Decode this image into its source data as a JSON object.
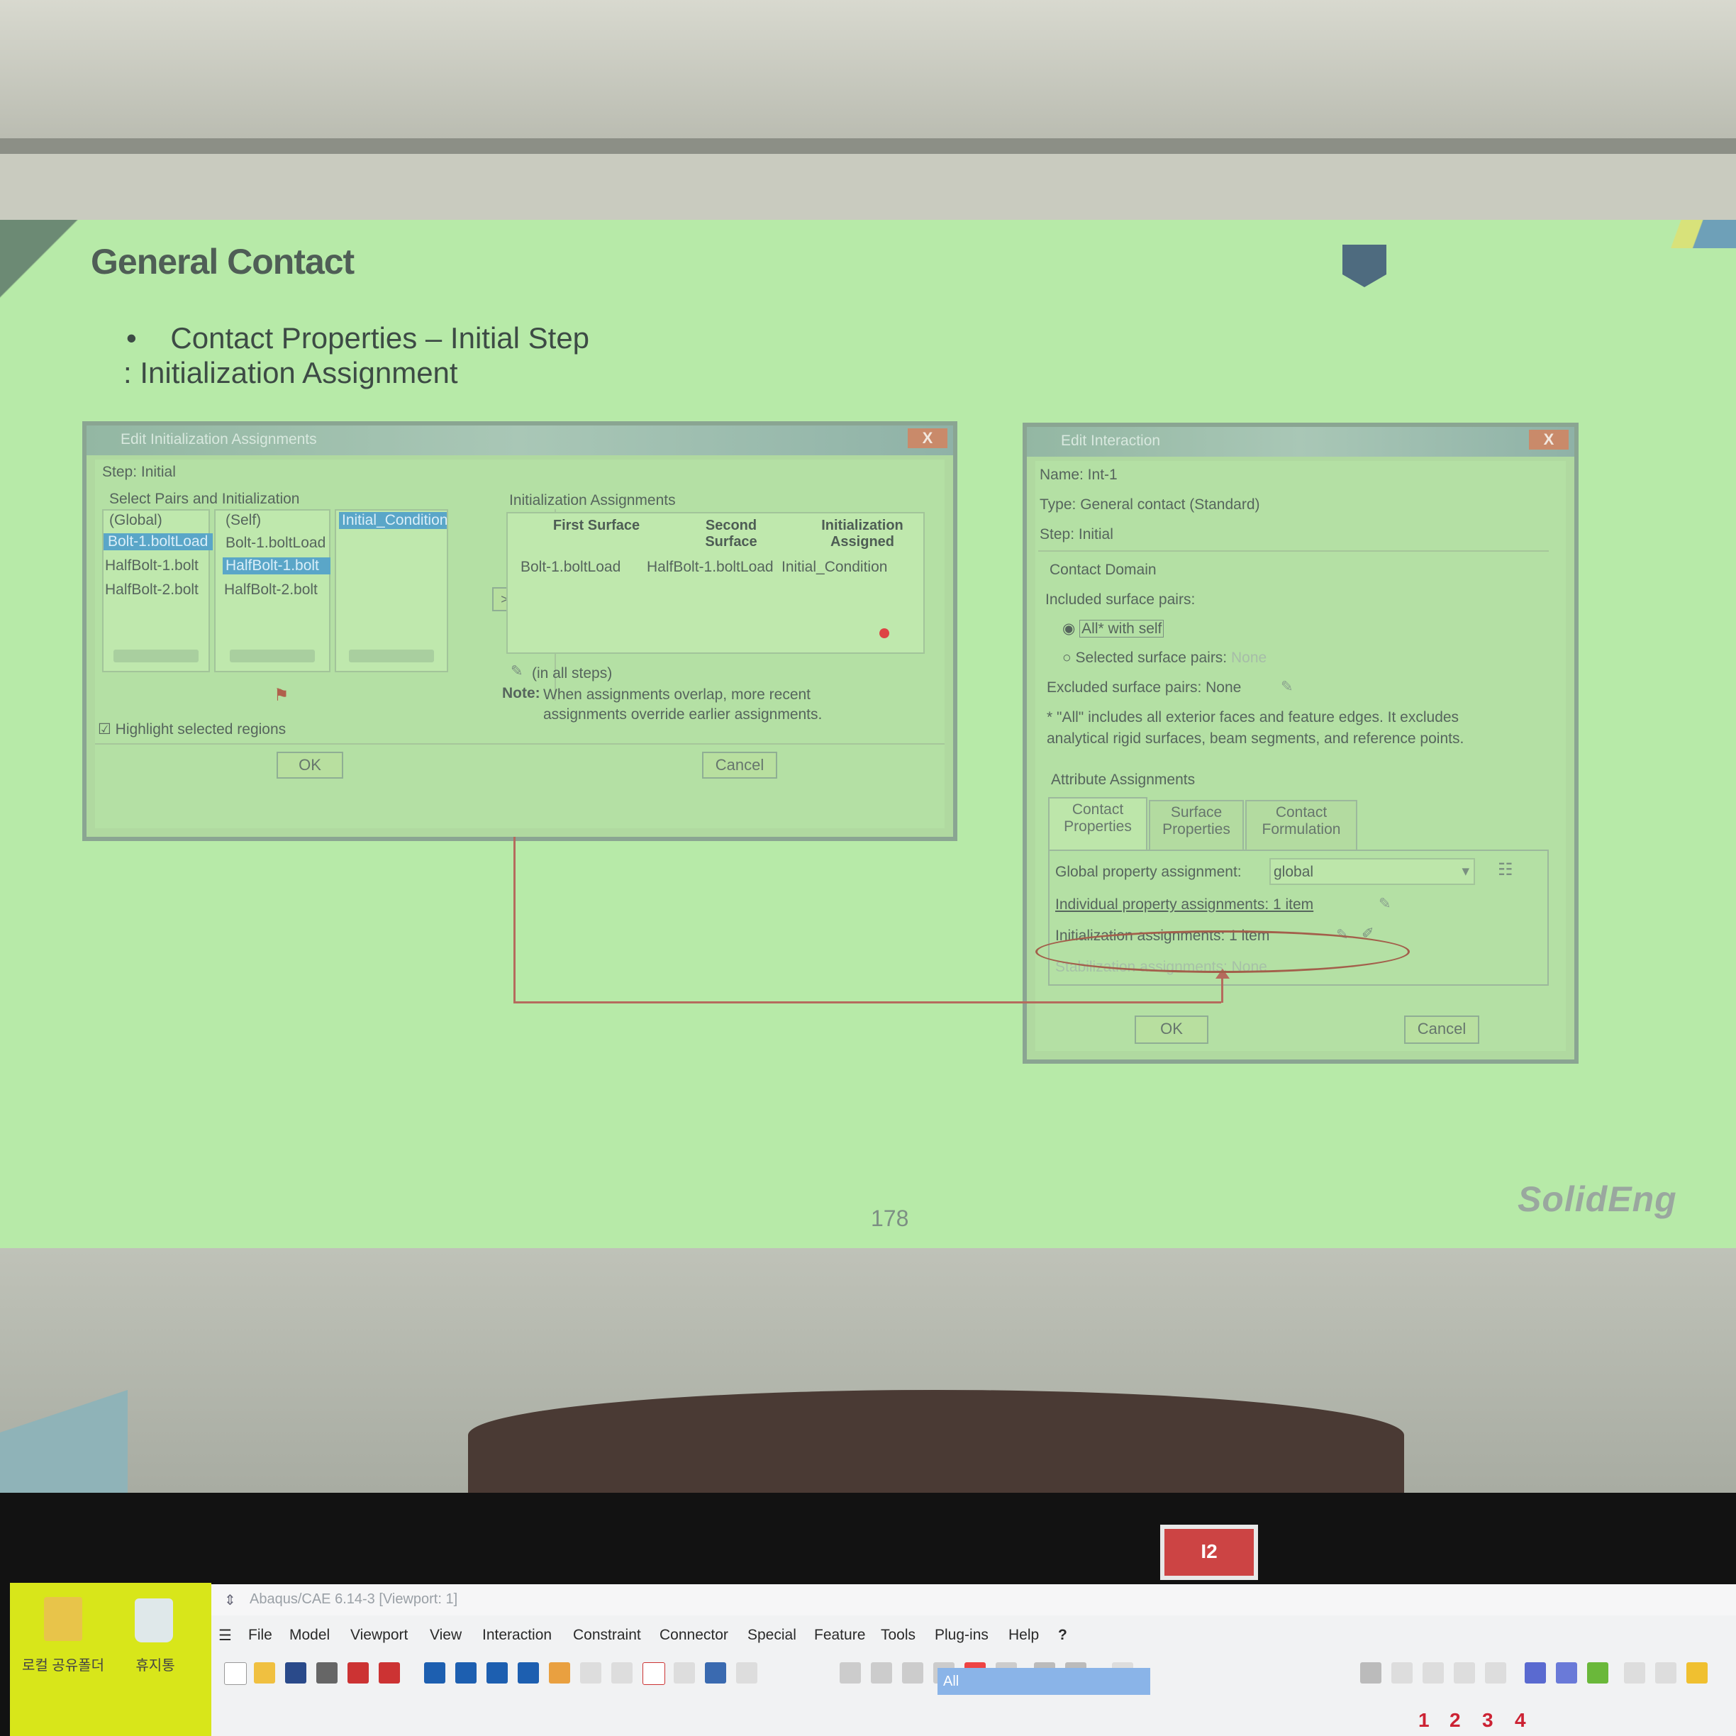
{
  "slide": {
    "title": "General Contact",
    "bullet_marker": "•",
    "bullet_1": "Contact Properties – Initial Step",
    "bullet_2": ": Initialization Assignment",
    "page_number": "178",
    "brand": "SolidEng"
  },
  "dialog_left": {
    "title": "Edit Initialization Assignments",
    "close": "X",
    "step_label": "Step: Initial",
    "select_pairs_label": "Select Pairs and Initialization",
    "col1": [
      "(Global)",
      "Bolt-1.boltLoad",
      "HalfBolt-1.bolt",
      "HalfBolt-2.bolt"
    ],
    "col2": [
      "(Self)",
      "Bolt-1.boltLoad",
      "HalfBolt-1.bolt",
      "HalfBolt-2.bolt"
    ],
    "col3": [
      "Initial_Condition"
    ],
    "arrow_button": ">>>",
    "assignments_label": "Initialization Assignments",
    "headers": [
      "First Surface",
      "Second Surface",
      "Initialization Assigned"
    ],
    "row": [
      "Bolt-1.boltLoad",
      "HalfBolt-1.boltLoad",
      "Initial_Condition"
    ],
    "in_all_steps": "(in all steps)",
    "note_label": "Note:",
    "note_text_1": "When assignments overlap, more recent",
    "note_text_2": "assignments override earlier assignments.",
    "highlight": "Highlight selected regions",
    "ok": "OK",
    "cancel": "Cancel"
  },
  "dialog_right": {
    "title": "Edit Interaction",
    "close": "X",
    "name": "Name:  Int-1",
    "type": "Type:    General contact (Standard)",
    "step": "Step:    Initial",
    "contact_domain": "Contact Domain",
    "included": "Included surface pairs:",
    "opt_all": "All* with self",
    "opt_selected": "Selected surface pairs:",
    "opt_selected_value": "None",
    "excluded": "Excluded surface pairs:  None",
    "footnote_1": "* \"All\" includes all exterior faces and feature edges. It excludes",
    "footnote_2": "analytical rigid surfaces, beam segments, and reference points.",
    "attr_label": "Attribute Assignments",
    "tabs": [
      "Contact Properties",
      "Surface Properties",
      "Contact Formulation"
    ],
    "global_prop_label": "Global property assignment:",
    "global_prop_value": "global",
    "individual": "Individual property assignments:  1 item",
    "initialization": "Initialization assignments:  1 item",
    "stabilization": "Stabilization assignments:  None",
    "ok": "OK",
    "cancel": "Cancel"
  },
  "monitor_label": "I2",
  "desktop_icons": [
    "로컬 공유폴더",
    "휴지통"
  ],
  "abaqus": {
    "title": "Abaqus/CAE 6.14-3 [Viewport: 1]",
    "menu": [
      "File",
      "Model",
      "Viewport",
      "View",
      "Interaction",
      "Constraint",
      "Connector",
      "Special",
      "Feature",
      "Tools",
      "Plug-ins",
      "Help",
      "?"
    ],
    "selection_filter": "All",
    "view_numbers": [
      "1",
      "2",
      "3",
      "4"
    ]
  },
  "colors": {
    "slide_bg": "#b7eaa8",
    "highlight_row": "#5aa6c8",
    "annotation_red": "#b56b5d"
  }
}
